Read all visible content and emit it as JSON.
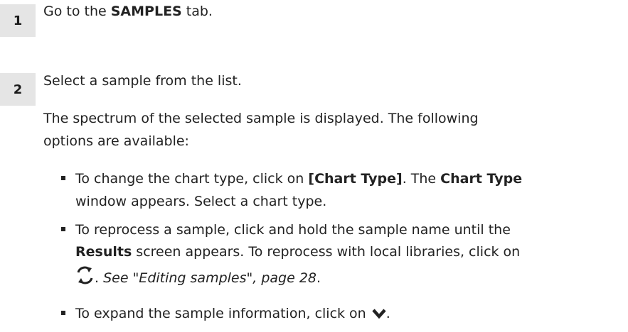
{
  "steps": [
    {
      "number": "1",
      "text_before": "Go to the ",
      "bold": "SAMPLES",
      "text_after": " tab."
    },
    {
      "number": "2",
      "text": "Select a sample from the list."
    }
  ],
  "description": {
    "line1": "The spectrum of the selected sample is displayed. The following",
    "line2": "options are available:"
  },
  "bullets": {
    "chart": {
      "l1_a": "To change the chart type, click on ",
      "l1_b": "[Chart Type]",
      "l1_c": ". The ",
      "l1_d": "Chart Type",
      "l2": "window appears. Select a chart type."
    },
    "reprocess": {
      "l1": "To reprocess a sample, click and hold the sample name until the",
      "l2_a": "Results",
      "l2_b": " screen appears. To reprocess with local libraries, click on",
      "l3_icon": "refresh-icon",
      "l3_a": ". ",
      "l3_b": "See \"Editing samples\", page 28",
      "l3_c": "."
    },
    "expand": {
      "l1": "To expand the sample information, click on ",
      "l1_icon": "chevron-down-icon",
      "l1_end": "."
    }
  }
}
